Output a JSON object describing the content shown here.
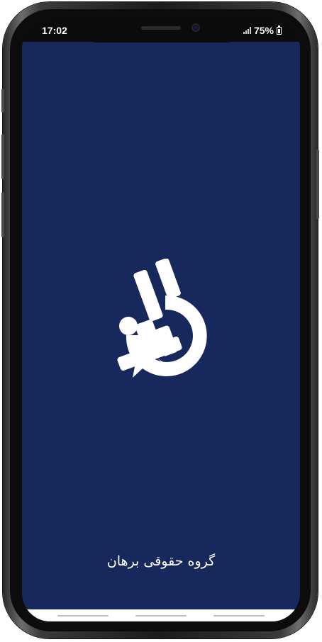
{
  "status_bar": {
    "time": "17:02",
    "battery": "75%",
    "icons": [
      "signal-icon",
      "battery-icon"
    ]
  },
  "splash": {
    "brand_name": "گروه حقوقی برهان",
    "logo": "borhan-logo-icon",
    "background_color": "#17285c",
    "logo_color": "#ffffff"
  },
  "nav_bar": {
    "buttons": [
      "recent-apps-button",
      "home-button",
      "back-button"
    ]
  }
}
